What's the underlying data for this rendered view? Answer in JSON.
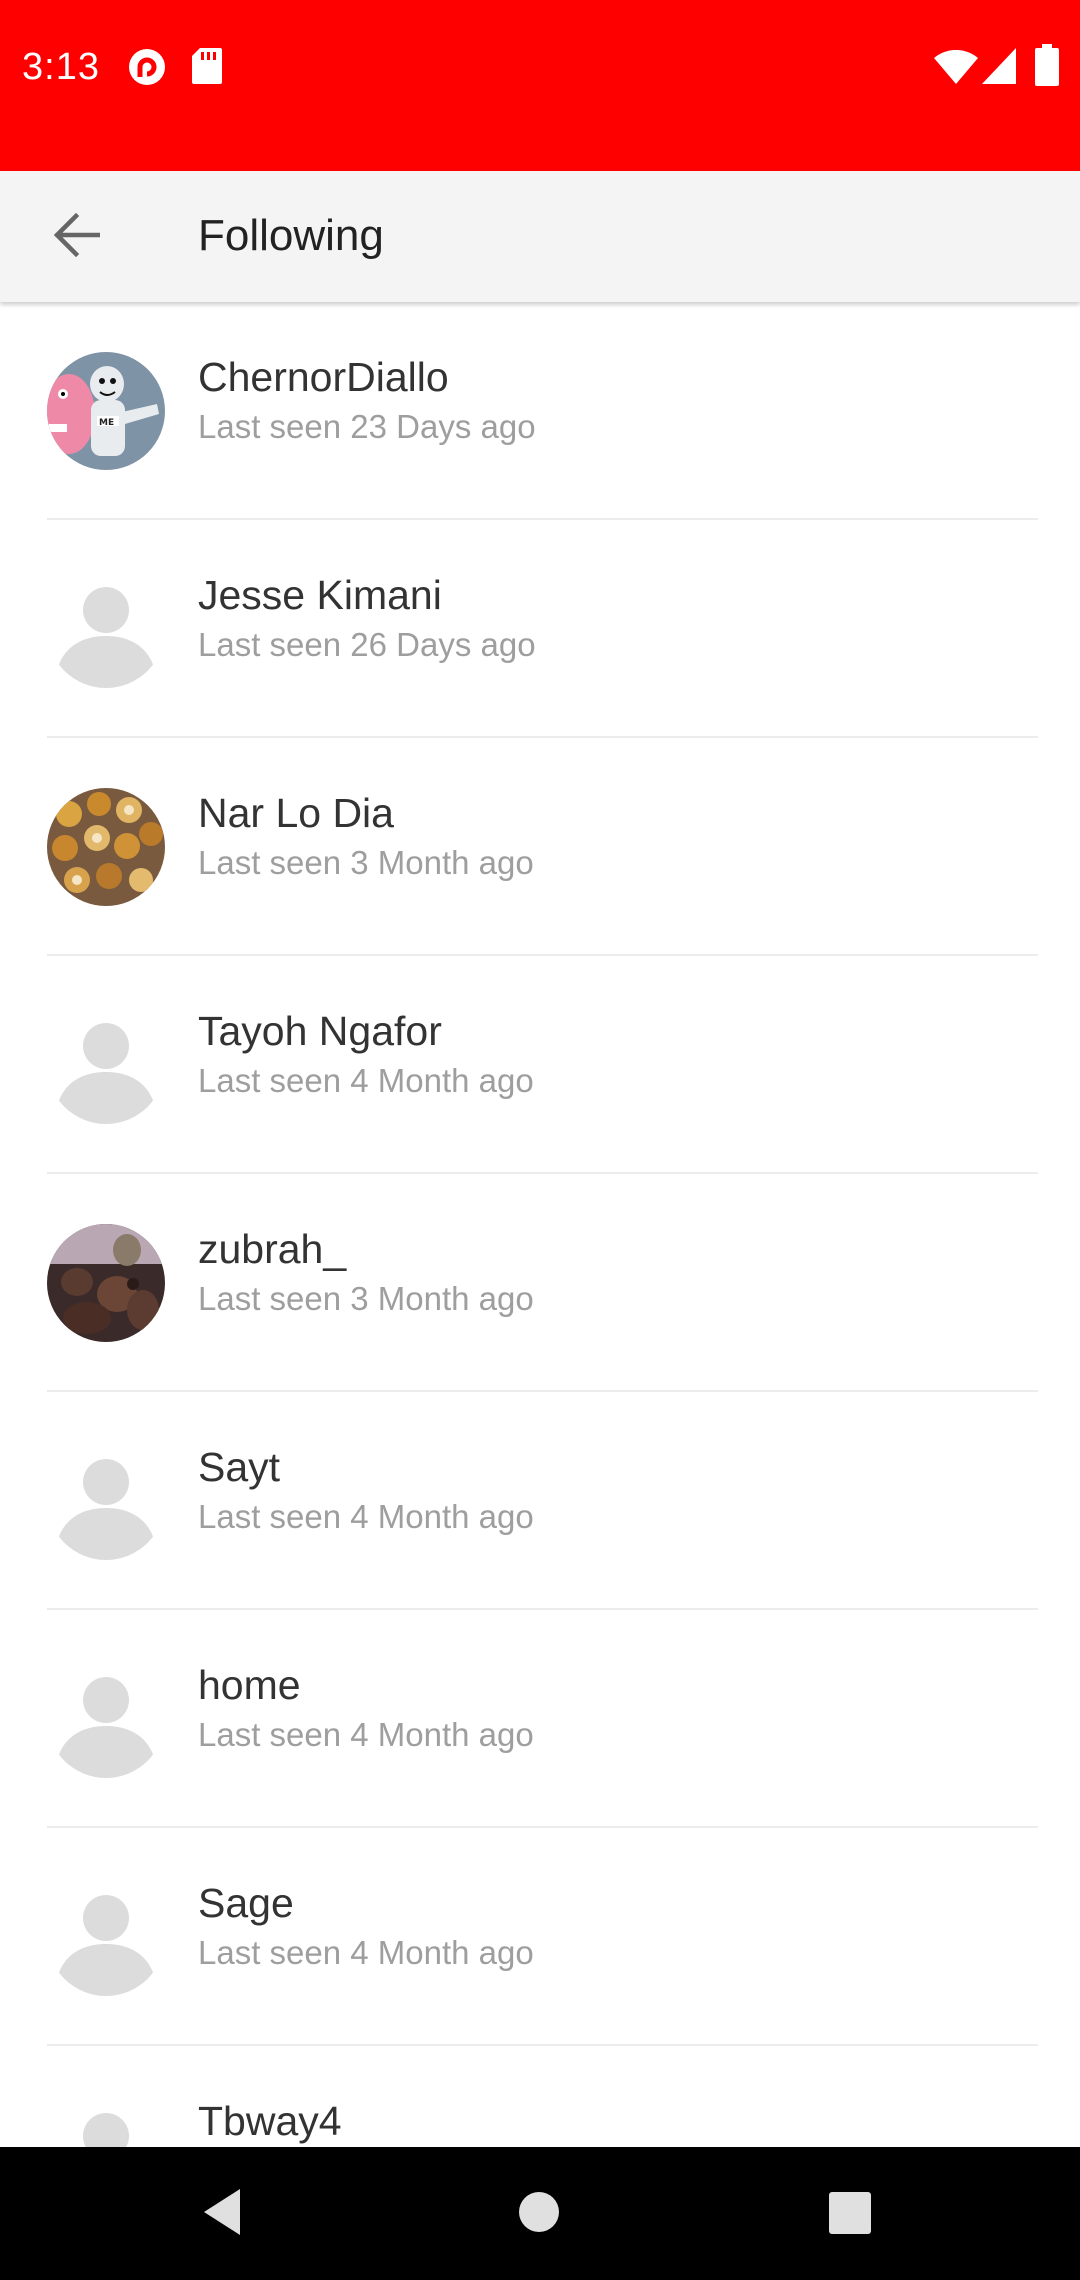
{
  "status_bar": {
    "time": "3:13",
    "background": "#ff0000",
    "left_icons": [
      "pocket-casts-icon",
      "sd-card-icon"
    ],
    "right_icons": [
      "wifi-icon",
      "cell-signal-icon",
      "battery-icon"
    ]
  },
  "app_bar": {
    "title": "Following",
    "back_icon": "arrow-back-icon"
  },
  "users": [
    {
      "name": "ChernorDiallo",
      "status": "Last seen 23 Days ago",
      "avatar": "photo-cartoon"
    },
    {
      "name": "Jesse Kimani",
      "status": "Last seen 26 Days ago",
      "avatar": "placeholder"
    },
    {
      "name": "Nar Lo Dia",
      "status": "Last seen 3 Month ago",
      "avatar": "photo-food"
    },
    {
      "name": "Tayoh Ngafor",
      "status": "Last seen 4 Month ago",
      "avatar": "placeholder"
    },
    {
      "name": "zubrah_",
      "status": "Last seen 3 Month ago",
      "avatar": "photo-group"
    },
    {
      "name": "Sayt",
      "status": "Last seen 4 Month ago",
      "avatar": "placeholder"
    },
    {
      "name": "home",
      "status": "Last seen 4 Month ago",
      "avatar": "placeholder"
    },
    {
      "name": "Sage",
      "status": "Last seen 4 Month ago",
      "avatar": "placeholder"
    },
    {
      "name": "Tbway4",
      "status": "",
      "avatar": "placeholder"
    }
  ],
  "nav_bar": {
    "buttons": [
      "nav-back-icon",
      "nav-home-icon",
      "nav-recents-icon"
    ]
  }
}
